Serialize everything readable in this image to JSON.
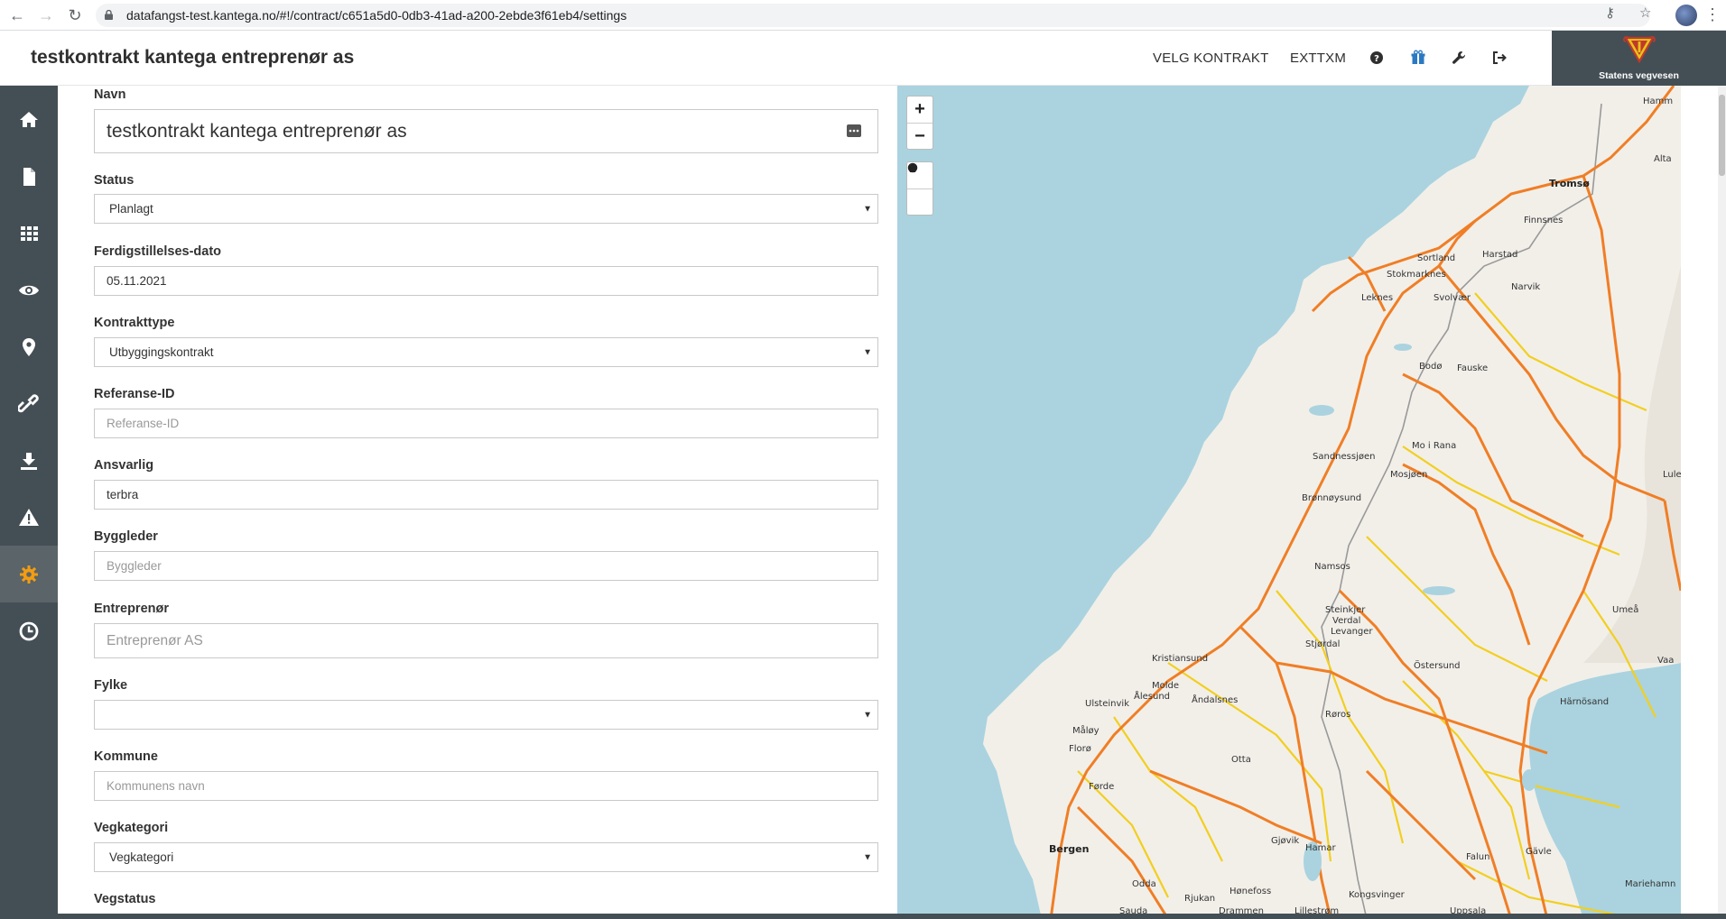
{
  "browser": {
    "url": "datafangst-test.kantega.no/#!/contract/c651a5d0-0db3-41ad-a200-2ebde3f61eb4/settings"
  },
  "header": {
    "title": "testkontrakt kantega entreprenør as",
    "links": [
      "VELG KONTRAKT",
      "EXTTXM"
    ],
    "logo_text": "Statens vegvesen"
  },
  "sidebar": {
    "items": [
      "home-icon",
      "document-icon",
      "grid-icon",
      "eye-icon",
      "map-pin-icon",
      "link-icon",
      "download-icon",
      "warning-icon",
      "settings-icon",
      "history-icon"
    ],
    "active_index": 8,
    "accent": "#f39c12"
  },
  "form": {
    "navn": {
      "label": "Navn",
      "value": "testkontrakt kantega entreprenør as"
    },
    "status": {
      "label": "Status",
      "value": "Planlagt"
    },
    "ferdig": {
      "label": "Ferdigstillelses-dato",
      "value": "05.11.2021"
    },
    "kontrakttype": {
      "label": "Kontrakttype",
      "value": "Utbyggingskontrakt"
    },
    "referanse": {
      "label": "Referanse-ID",
      "placeholder": "Referanse-ID"
    },
    "ansvarlig": {
      "label": "Ansvarlig",
      "value": "terbra"
    },
    "byggleder": {
      "label": "Byggleder",
      "placeholder": "Byggleder"
    },
    "entreprenor": {
      "label": "Entreprenør",
      "placeholder": "Entreprenør AS"
    },
    "fylke": {
      "label": "Fylke",
      "value": ""
    },
    "kommune": {
      "label": "Kommune",
      "placeholder": "Kommunens navn"
    },
    "vegkategori": {
      "label": "Vegkategori",
      "value": "Vegkategori"
    },
    "vegstatus": {
      "label": "Vegstatus"
    }
  },
  "map": {
    "zoom_in": "+",
    "zoom_out": "−",
    "places": [
      {
        "name": "Hammerfest",
        "label": "Hamm"
      },
      {
        "name": "Alta",
        "label": "Alta"
      },
      {
        "name": "Tromsø",
        "label": "Tromsø"
      },
      {
        "name": "Finnsnes",
        "label": "Finnsnes"
      },
      {
        "name": "Sortland",
        "label": "Sortland"
      },
      {
        "name": "Harstad",
        "label": "Harstad"
      },
      {
        "name": "Stokmarknes",
        "label": "Stokmarknes"
      },
      {
        "name": "Narvik",
        "label": "Narvik"
      },
      {
        "name": "Leknes",
        "label": "Leknes"
      },
      {
        "name": "Svolvær",
        "label": "Svolvær"
      },
      {
        "name": "Bodø",
        "label": "Bodø"
      },
      {
        "name": "Fauske",
        "label": "Fauske"
      },
      {
        "name": "Mo i Rana",
        "label": "Mo i Rana"
      },
      {
        "name": "Sandnessjøen",
        "label": "Sandnessjøen"
      },
      {
        "name": "Mosjøen",
        "label": "Mosjøen"
      },
      {
        "name": "Luleå",
        "label": "Lule"
      },
      {
        "name": "Brønnøysund",
        "label": "Brønnøysund"
      },
      {
        "name": "Namsos",
        "label": "Namsos"
      },
      {
        "name": "Steinkjer",
        "label": "Steinkjer"
      },
      {
        "name": "Verdal",
        "label": "Verdal"
      },
      {
        "name": "Levanger",
        "label": "Levanger"
      },
      {
        "name": "Stjørdal",
        "label": "Stjørdal"
      },
      {
        "name": "Umeå",
        "label": "Umeå"
      },
      {
        "name": "Kristiansund",
        "label": "Kristiansund"
      },
      {
        "name": "Östersund",
        "label": "Östersund"
      },
      {
        "name": "Molde",
        "label": "Molde"
      },
      {
        "name": "Ålesund",
        "label": "Ålesund"
      },
      {
        "name": "Åndalsnes",
        "label": "Åndalsnes"
      },
      {
        "name": "Ulsteinvik",
        "label": "Ulsteinvik"
      },
      {
        "name": "Røros",
        "label": "Røros"
      },
      {
        "name": "Härnösand",
        "label": "Härnösand"
      },
      {
        "name": "Måløy",
        "label": "Måløy"
      },
      {
        "name": "Florø",
        "label": "Florø"
      },
      {
        "name": "Otta",
        "label": "Otta"
      },
      {
        "name": "Førde",
        "label": "Førde"
      },
      {
        "name": "Bergen",
        "label": "Bergen"
      },
      {
        "name": "Gjøvik",
        "label": "Gjøvik"
      },
      {
        "name": "Hamar",
        "label": "Hamar"
      },
      {
        "name": "Falun",
        "label": "Falun"
      },
      {
        "name": "Gävle",
        "label": "Gävle"
      },
      {
        "name": "Mariehamn",
        "label": "Mariehamn"
      },
      {
        "name": "Odda",
        "label": "Odda"
      },
      {
        "name": "Hønefoss",
        "label": "Hønefoss"
      },
      {
        "name": "Kongsvinger",
        "label": "Kongsvinger"
      },
      {
        "name": "Sauda",
        "label": "Sauda"
      },
      {
        "name": "Rjukan",
        "label": "Rjukan"
      },
      {
        "name": "Drammen",
        "label": "Drammen"
      },
      {
        "name": "Lillestrøm",
        "label": "Lillestrøm"
      },
      {
        "name": "Uppsala",
        "label": "Uppsala"
      },
      {
        "name": "Vaasa",
        "label": "Vaa"
      }
    ]
  }
}
